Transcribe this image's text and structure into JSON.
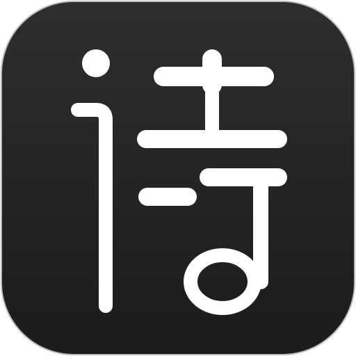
{
  "icon": {
    "name": "诗",
    "glyph_label": "诗",
    "background_color": "#1b1b1b",
    "gradient_light": "#2e2e2e",
    "border_color": "#b8b8b8",
    "glyph_color": "#ffffff",
    "shape": "rounded-square"
  }
}
